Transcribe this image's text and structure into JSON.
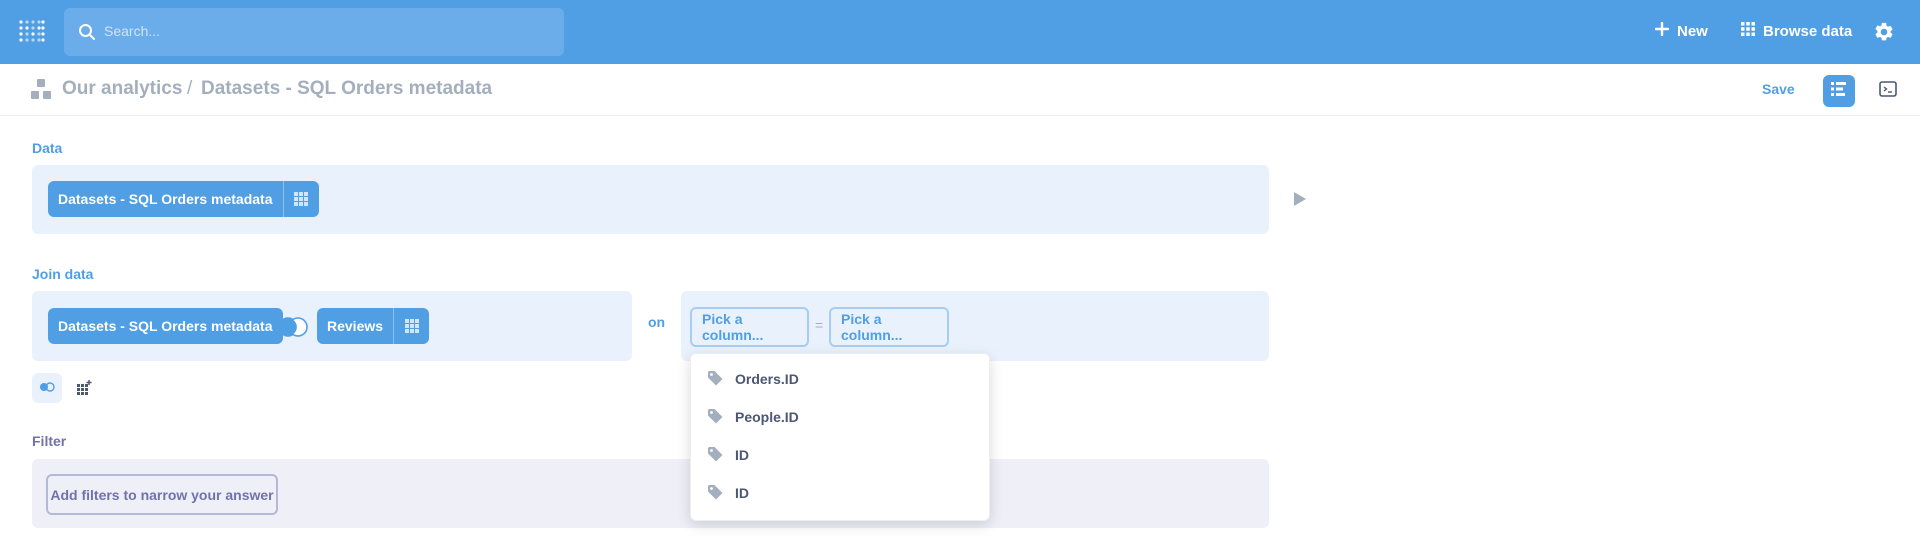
{
  "nav": {
    "search_placeholder": "Search...",
    "new_label": "New",
    "browse_label": "Browse data",
    "color": "#509ee3"
  },
  "header": {
    "collection": "Our analytics",
    "separator": "/",
    "title": "Datasets - SQL Orders metadata",
    "save_label": "Save"
  },
  "data_section": {
    "label": "Data",
    "source": "Datasets - SQL Orders metadata"
  },
  "join_section": {
    "label": "Join data",
    "left_table": "Datasets - SQL Orders metadata",
    "right_table": "Reviews",
    "on_label": "on",
    "left_column_placeholder": "Pick a column...",
    "equals": "=",
    "right_column_placeholder": "Pick a column..."
  },
  "column_dropdown": {
    "options": [
      {
        "label": "Orders.ID",
        "icon": "tag-icon"
      },
      {
        "label": "People.ID",
        "icon": "tag-icon"
      },
      {
        "label": "ID",
        "icon": "tag-icon"
      },
      {
        "label": "ID",
        "icon": "tag-icon"
      }
    ]
  },
  "filter_section": {
    "label": "Filter",
    "add_label": "Add filters to narrow your answer"
  }
}
